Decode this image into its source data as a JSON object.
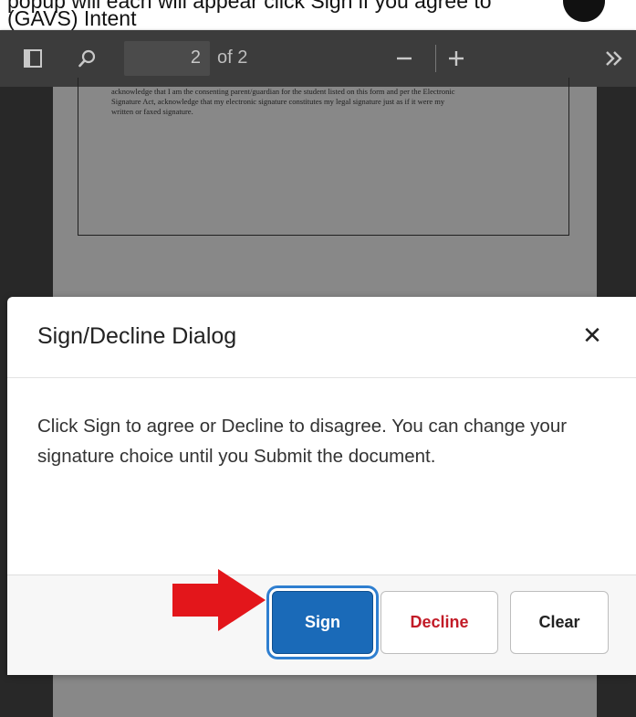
{
  "caption": {
    "line1": "popup will each will appear click Sign if you agree to",
    "line2": "(GAVS) Intent"
  },
  "toolbar": {
    "current_page": "2",
    "page_of": "of 2",
    "icons": [
      "sidebar-toggle-icon",
      "search-icon",
      "zoom-out-icon",
      "zoom-in-icon",
      "more-tools-icon"
    ]
  },
  "document": {
    "text_lines": [
      "acknowledge that I am the consenting parent/guardian for the student listed on this form and per the Electronic",
      "Signature Act, acknowledge that my electronic signature constitutes my legal signature just as if it were my",
      "written or faxed signature."
    ]
  },
  "dialog": {
    "title": "Sign/Decline Dialog",
    "close_icon": "close-icon",
    "body": "Click Sign to agree or Decline to disagree. You can change your signature choice until you Submit the document.",
    "buttons": {
      "sign": "Sign",
      "decline": "Decline",
      "clear": "Clear"
    }
  },
  "colors": {
    "accent_blue": "#1a6ab8",
    "decline_red": "#c21b27",
    "annotation_arrow": "#e3161b"
  }
}
